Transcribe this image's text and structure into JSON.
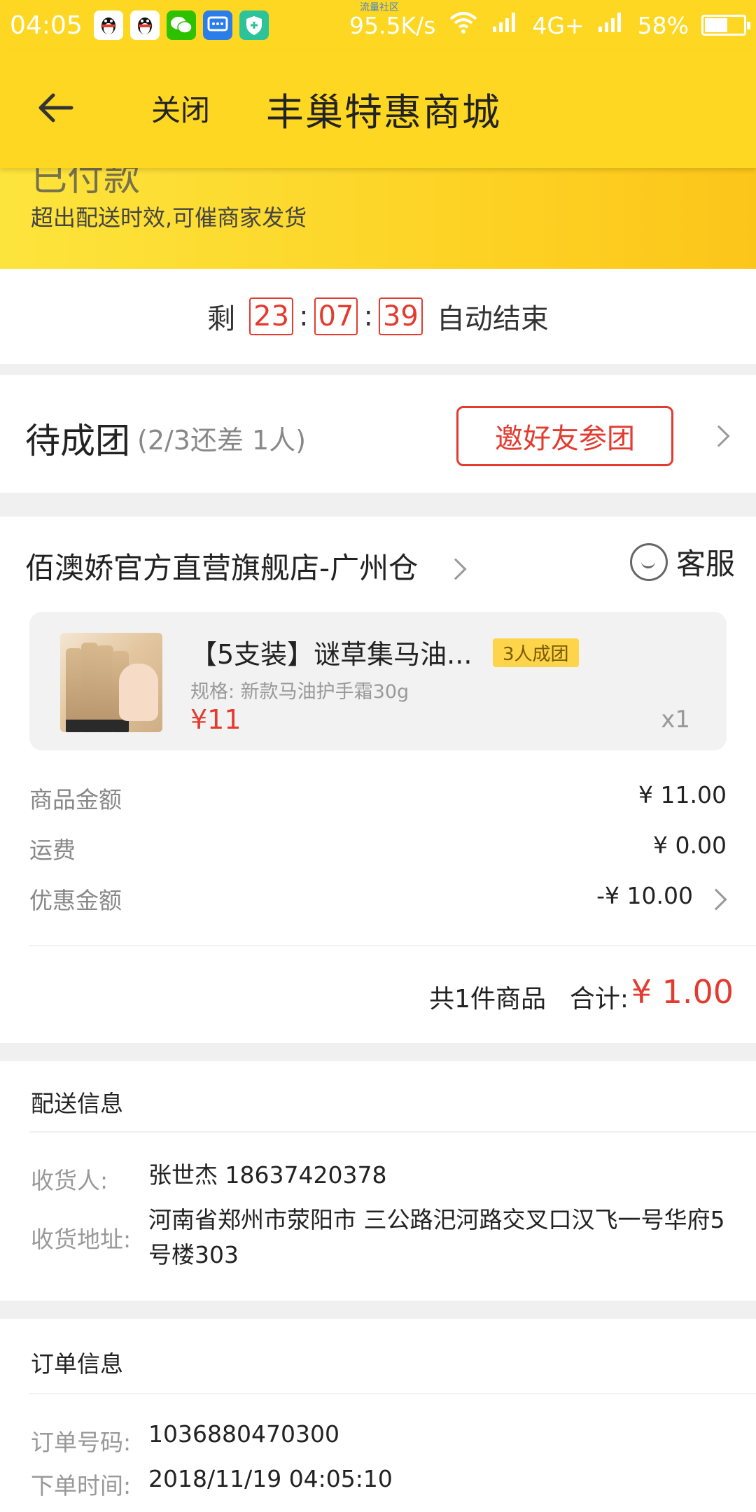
{
  "status_bar": {
    "time": "04:05",
    "tiny_label": "流量社区",
    "net_speed": "95.5K/s",
    "network": "4G+",
    "battery": "58%"
  },
  "header": {
    "close_label": "关闭",
    "title": "丰巢特惠商城"
  },
  "banner": {
    "status": "已付款",
    "tip": "超出配送时效,可催商家发货"
  },
  "countdown": {
    "prefix": "剩",
    "hours": "23",
    "minutes": "07",
    "seconds": "39",
    "separator": ":",
    "suffix": "自动结束"
  },
  "group": {
    "title": "待成团",
    "progress": "(2/3还差 1人)",
    "invite_label": "邀好友参团"
  },
  "store": {
    "name": "佰澳娇官方直营旗舰店-广州仓",
    "customer_service": "客服"
  },
  "product": {
    "title": "【5支装】谜草集马油...",
    "tag": "3人成团",
    "spec": "规格: 新款马油护手霜30g",
    "price": "¥11",
    "qty": "x1"
  },
  "amounts": {
    "goods_label": "商品金额",
    "goods_value": "¥ 11.00",
    "shipping_label": "运费",
    "shipping_value": "¥ 0.00",
    "discount_label": "优惠金额",
    "discount_value": "-¥ 10.00"
  },
  "total": {
    "count_text": "共1件商品",
    "label": "合计:",
    "value": "¥ 1.00"
  },
  "delivery": {
    "section_title": "配送信息",
    "receiver_label": "收货人:",
    "receiver_value": "张世杰  18637420378",
    "address_label": "收货地址:",
    "address_value": "河南省郑州市荥阳市 三公路汜河路交叉口汉飞一号华府5号楼303"
  },
  "order": {
    "section_title": "订单信息",
    "number_label": "订单号码:",
    "number_value": "1036880470300",
    "time_label": "下单时间:",
    "time_value": "2018/11/19 04:05:10"
  },
  "colors": {
    "header_yellow": "#fdd722",
    "accent_red": "#e33b2f"
  }
}
